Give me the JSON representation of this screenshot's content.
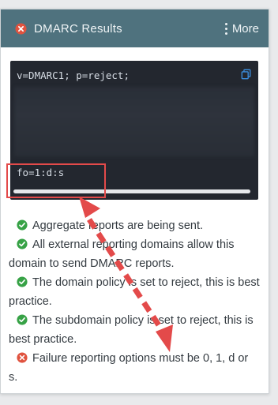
{
  "header": {
    "title": "DMARC Results",
    "more_label": "More"
  },
  "code": {
    "line1": "v=DMARC1; p=reject;",
    "line2": "fo=1:d:s"
  },
  "results": [
    {
      "status": "pass",
      "icon": "check-circle-icon",
      "text": "Aggregate reports are being sent."
    },
    {
      "status": "pass",
      "icon": "check-circle-icon",
      "text": "All external reporting domains allow this domain to send DMARC reports."
    },
    {
      "status": "pass",
      "icon": "check-circle-icon",
      "text": "The domain policy is set to reject, this is best practice."
    },
    {
      "status": "pass",
      "icon": "check-circle-icon",
      "text": "The subdomain policy is set to reject, this is best practice."
    },
    {
      "status": "fail",
      "icon": "x-circle-icon",
      "text": "Failure reporting options must be 0, 1, d or s."
    }
  ],
  "colors": {
    "header_bg": "#4f727e",
    "pass": "#37a246",
    "fail": "#e0533f",
    "annotation": "#e34a4a"
  }
}
